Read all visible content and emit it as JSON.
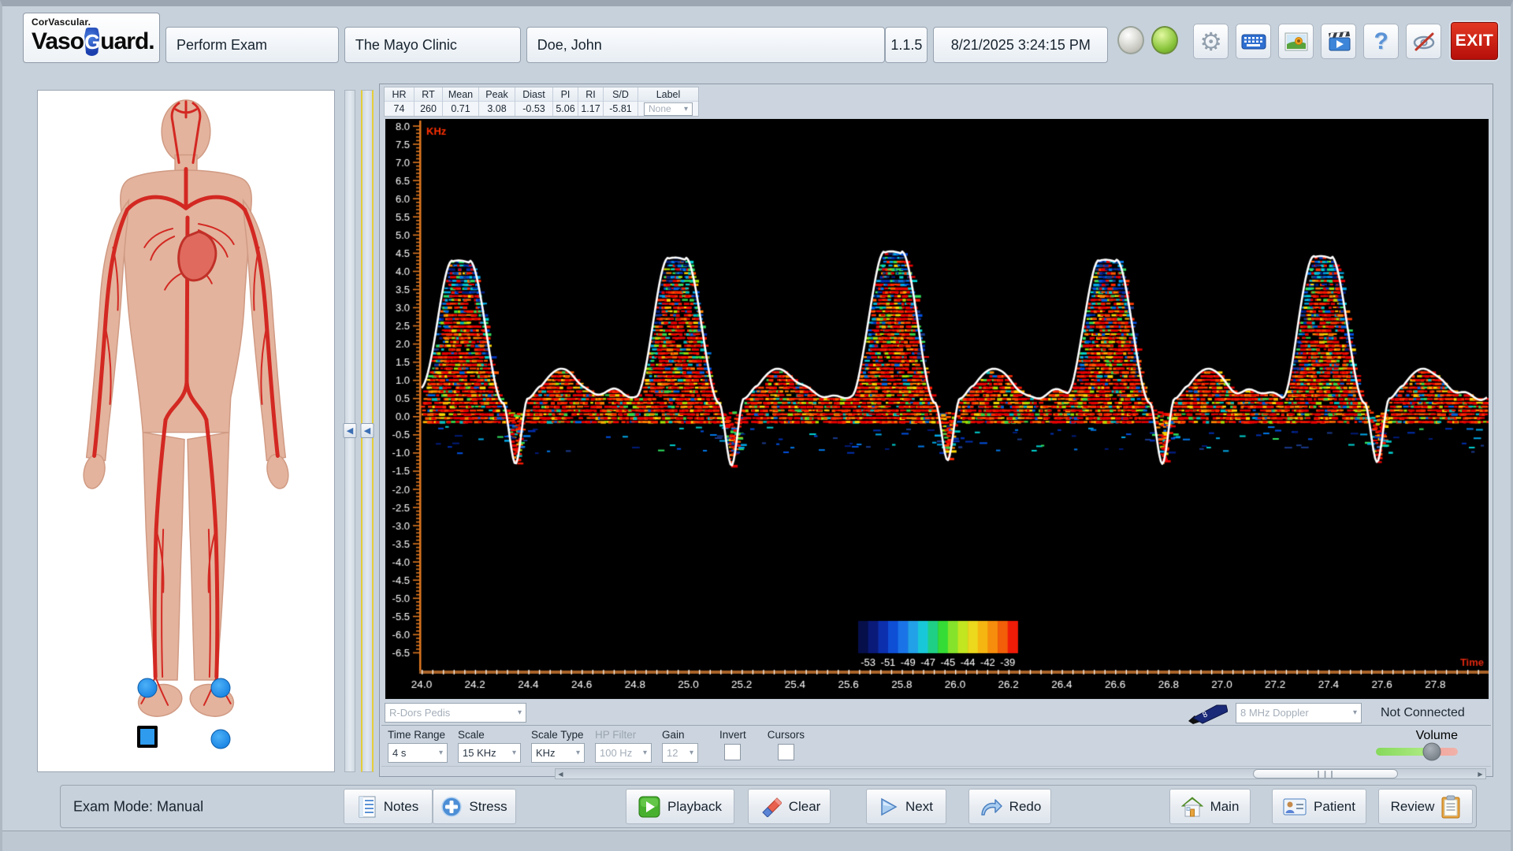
{
  "brand": {
    "company": "CorVascular.",
    "name_part1": "Vaso",
    "name_g": "G",
    "name_part2": "uard."
  },
  "header": {
    "mode": "Perform Exam",
    "facility": "The Mayo Clinic",
    "patient": "Doe, John",
    "version": "1.1.5",
    "datetime": "8/21/2025 3:24:15 PM"
  },
  "toolbar": {
    "exit_label": "EXIT"
  },
  "site_row": {
    "site": "R-Dors Pedis",
    "probe_digit": "8",
    "probe": "8 MHz Doppler",
    "status": "Not Connected"
  },
  "controls": {
    "time_range_label": "Time Range",
    "time_range_value": "4 s",
    "scale_label": "Scale",
    "scale_value": "15 KHz",
    "scale_type_label": "Scale Type",
    "scale_type_value": "KHz",
    "hp_filter_label": "HP Filter",
    "hp_filter_value": "100 Hz",
    "gain_label": "Gain",
    "gain_value": "12",
    "invert_label": "Invert",
    "invert_checked": false,
    "cursors_label": "Cursors",
    "cursors_checked": false,
    "volume_label": "Volume",
    "volume_pct": 68
  },
  "footer": {
    "exam_mode": "Exam Mode: Manual",
    "buttons": [
      {
        "label": "Notes"
      },
      {
        "label": "Stress"
      },
      {
        "label": "Playback"
      },
      {
        "label": "Clear"
      },
      {
        "label": "Next"
      },
      {
        "label": "Redo"
      },
      {
        "label": "Main"
      },
      {
        "label": "Patient"
      },
      {
        "label": "Review"
      }
    ]
  },
  "body_map": {
    "marker_color": "#2196f3",
    "sites": [
      {
        "id": "site-right-calf",
        "shape": "circle",
        "x_pct": 37.1,
        "y_pct": 87.7,
        "selected": false
      },
      {
        "id": "site-left-calf",
        "shape": "circle",
        "x_pct": 61.8,
        "y_pct": 87.7,
        "selected": false
      },
      {
        "id": "site-right-ankle",
        "shape": "square",
        "x_pct": 37.1,
        "y_pct": 94.9,
        "selected": true
      },
      {
        "id": "site-left-ankle",
        "shape": "circle",
        "x_pct": 61.8,
        "y_pct": 95.2,
        "selected": false
      }
    ]
  },
  "chart_data": {
    "type": "doppler_spectrogram",
    "ylabel": "KHz",
    "xlabel": "Time",
    "y_ticks": {
      "max": 8.0,
      "min": -6.5,
      "step": 0.5
    },
    "x_ticks": {
      "min": 24.0,
      "max": 27.8,
      "step": 0.2
    },
    "x_range_s": [
      24.0,
      28.0
    ],
    "heart_rate_bpm": 74,
    "pulses": {
      "peak_times_s": [
        24.14,
        24.95,
        25.76,
        26.565,
        27.37
      ],
      "peak_khz": [
        4.3,
        4.38,
        4.55,
        4.32,
        4.42
      ],
      "dip_khz": [
        -1.3,
        -1.35,
        -1.2,
        -1.3,
        -1.25
      ],
      "diastolic_bump_khz": 1.32,
      "baseline_khz": 0.62
    },
    "measurements": [
      {
        "label": "HR",
        "value": "74"
      },
      {
        "label": "RT",
        "value": "260"
      },
      {
        "label": "Mean",
        "value": "0.71"
      },
      {
        "label": "Peak",
        "value": "3.08"
      },
      {
        "label": "Diast",
        "value": "-0.53"
      },
      {
        "label": "PI",
        "value": "5.06"
      },
      {
        "label": "RI",
        "value": "1.17"
      },
      {
        "label": "S/D",
        "value": "-5.81"
      }
    ],
    "label_dropdown": {
      "label": "Label",
      "value": "None"
    },
    "colorbar": {
      "labels": [
        "-53",
        "-51",
        "-49",
        "-47",
        "-45",
        "-44",
        "-42",
        "-39"
      ],
      "colors": [
        "#060f4a",
        "#0a1a78",
        "#0c2fae",
        "#0e4fd6",
        "#1a74e8",
        "#22a0e8",
        "#19c8d8",
        "#1fcf86",
        "#35dc35",
        "#84e32a",
        "#c2e620",
        "#ecd81c",
        "#f6b612",
        "#f78d0c",
        "#f25f08",
        "#ef1c08"
      ]
    },
    "colors": {
      "background": "#000000",
      "envelope": "#ffffff",
      "axis": "#e07820",
      "x_axis_bar": "#a96328",
      "tick_labels": "#ffffff",
      "unit_labels": "#ff3000",
      "speckle_warm": [
        "#e80000",
        "#f51800",
        "#ff2a00",
        "#ff3c00",
        "#ff5a00",
        "#ff8400",
        "#ffb000",
        "#ffd800",
        "#a8e000",
        "#38d848",
        "#00c0c0",
        "#0064e0"
      ],
      "speckle_cold": [
        "#001c7a",
        "#0030b0",
        "#0050e0",
        "#0078e8",
        "#00a8e8",
        "#00d0d0",
        "#1a3a8c",
        "#30e060"
      ]
    }
  }
}
